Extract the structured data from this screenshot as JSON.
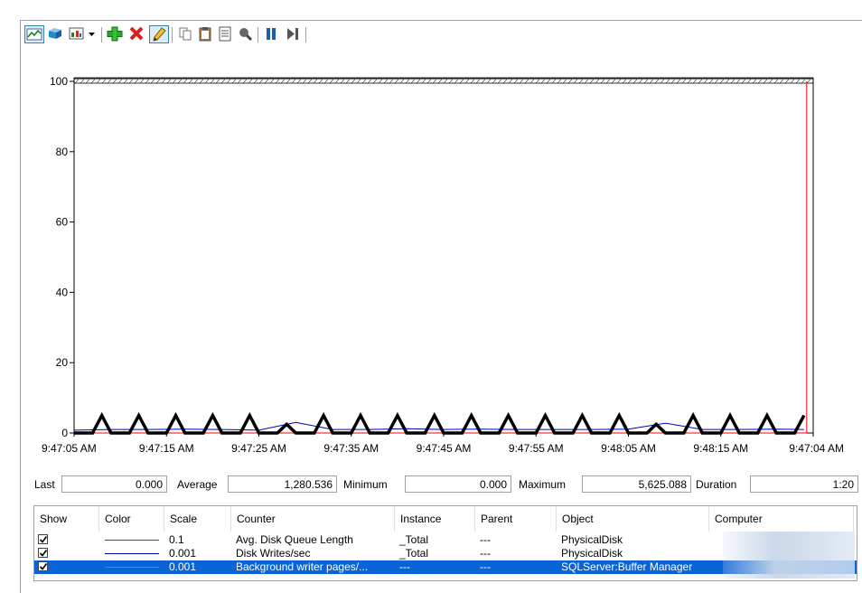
{
  "toolbar": {
    "buttons": [
      {
        "name": "view-graph-icon",
        "active": true
      },
      {
        "name": "view-histogram-icon"
      },
      {
        "name": "change-graph-type-icon"
      },
      {
        "name": "dropdown-arrow-icon"
      },
      {
        "name": "add-counter-icon"
      },
      {
        "name": "delete-counter-icon"
      },
      {
        "name": "highlight-icon"
      },
      {
        "name": "copy-properties-icon"
      },
      {
        "name": "paste-counter-list-icon"
      },
      {
        "name": "properties-icon"
      },
      {
        "name": "zoom-icon"
      },
      {
        "name": "freeze-display-icon"
      },
      {
        "name": "update-data-icon"
      }
    ]
  },
  "chart_data": {
    "type": "line",
    "title": "",
    "xlabel": "",
    "ylabel": "",
    "ylim": [
      0,
      100
    ],
    "yticks": [
      "100",
      "80",
      "60",
      "40",
      "20",
      "0"
    ],
    "xticks": [
      "9:47:05 AM",
      "9:47:15 AM",
      "9:47:25 AM",
      "9:47:35 AM",
      "9:47:45 AM",
      "9:47:55 AM",
      "9:48:05 AM",
      "9:48:15 AM",
      "9:47:04 AM"
    ],
    "duration_seconds": 80,
    "series": [
      {
        "name": "Avg. Disk Queue Length",
        "color": "#ff0000",
        "scale": "0.1",
        "x": [
          0,
          10,
          20,
          30,
          40,
          50,
          60,
          70,
          79.3,
          79.3
        ],
        "y": [
          0,
          0,
          0,
          0,
          0,
          0,
          0,
          0,
          0,
          100
        ]
      },
      {
        "name": "Disk Writes/sec",
        "color": "#0000c0",
        "scale": "0.001",
        "x": [
          0,
          4,
          8,
          12,
          16,
          20,
          24,
          28,
          32,
          36,
          40,
          44,
          48,
          52,
          56,
          60,
          64,
          68,
          72,
          76,
          79
        ],
        "y": [
          0.8,
          1.0,
          1.0,
          1.1,
          1.0,
          0.8,
          3.0,
          1.0,
          1.0,
          1.2,
          1.0,
          1.1,
          1.0,
          1.0,
          1.0,
          1.1,
          2.8,
          1.0,
          1.0,
          1.1,
          1.0
        ]
      },
      {
        "name": "Background writer pages/sec",
        "color": "#000000",
        "scale": "0.001",
        "x": [
          0,
          2,
          3,
          4,
          6,
          7,
          8,
          10,
          11,
          12,
          14,
          15,
          16,
          18,
          19,
          20,
          22,
          23,
          24,
          26,
          27,
          28,
          30,
          31,
          32,
          34,
          35,
          36,
          38,
          39,
          40,
          42,
          43,
          44,
          46,
          47,
          48,
          50,
          51,
          52,
          54,
          55,
          56,
          58,
          59,
          60,
          62,
          63,
          64,
          66,
          67,
          68,
          70,
          71,
          72,
          74,
          75,
          76,
          78,
          79
        ],
        "y": [
          0,
          0,
          5,
          0,
          0,
          5,
          0,
          0,
          5,
          0,
          0,
          5,
          0,
          0,
          5,
          0,
          0,
          2.5,
          0,
          0,
          5,
          0,
          0,
          5,
          0,
          0,
          5,
          0,
          0,
          5,
          0,
          0,
          5,
          0,
          0,
          5,
          0,
          0,
          5,
          0,
          0,
          5,
          0,
          0,
          5,
          0,
          0,
          2.5,
          0,
          0,
          5,
          0,
          0,
          5,
          0,
          0,
          5,
          0,
          0,
          5
        ]
      }
    ]
  },
  "stats": {
    "last_label": "Last",
    "last": "0.000",
    "average_label": "Average",
    "average": "1,280.536",
    "minimum_label": "Minimum",
    "minimum": "0.000",
    "maximum_label": "Maximum",
    "maximum": "5,625.088",
    "duration_label": "Duration",
    "duration": "1:20"
  },
  "counters": {
    "headers": [
      "Show",
      "Color",
      "Scale",
      "Counter",
      "Instance",
      "Parent",
      "Object",
      "Computer"
    ],
    "rows": [
      {
        "show": true,
        "color": "#ff0000",
        "scale": "0.1",
        "counter": "Avg. Disk Queue Length",
        "instance": "_Total",
        "parent": "---",
        "object": "PhysicalDisk",
        "computer": "",
        "selected": false
      },
      {
        "show": true,
        "color": "#0000c0",
        "scale": "0.001",
        "counter": "Disk Writes/sec",
        "instance": "_Total",
        "parent": "---",
        "object": "PhysicalDisk",
        "computer": "",
        "selected": false
      },
      {
        "show": true,
        "color": "#00c080",
        "scale": "0.001",
        "counter": "Background writer pages/...",
        "instance": "---",
        "parent": "---",
        "object": "SQLServer:Buffer Manager",
        "computer": "",
        "selected": true
      }
    ]
  }
}
